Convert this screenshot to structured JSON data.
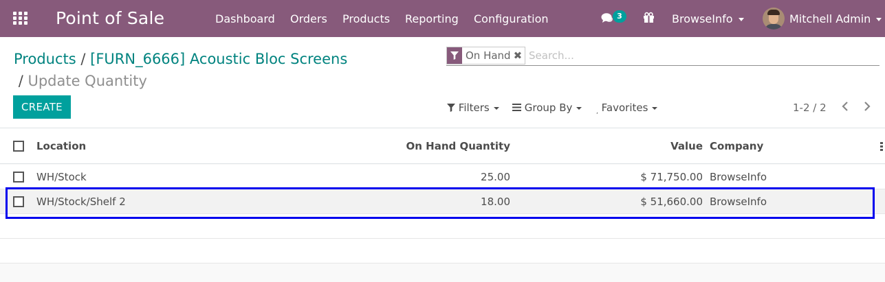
{
  "navbar": {
    "app_title": "Point of Sale",
    "menus": [
      "Dashboard",
      "Orders",
      "Products",
      "Reporting",
      "Configuration"
    ],
    "messages_badge": "3",
    "company": "BrowseInfo",
    "user": "Mitchell Admin",
    "bg_color": "#875a7b"
  },
  "breadcrumb": {
    "items": [
      "Products",
      "[FURN_6666] Acoustic Bloc Screens"
    ],
    "current": "Update Quantity"
  },
  "toolbar": {
    "create_label": "CREATE",
    "filters_label": "Filters",
    "groupby_label": "Group By",
    "favorites_label": "Favorites",
    "pager": "1-2 / 2"
  },
  "search": {
    "facet_label": "On Hand",
    "facet_icon": "filter-icon",
    "placeholder": "Search..."
  },
  "table": {
    "columns": [
      "Location",
      "On Hand Quantity",
      "Value",
      "Company"
    ],
    "rows": [
      {
        "location": "WH/Stock",
        "quantity": "25.00",
        "value": "$ 71,750.00",
        "company": "BrowseInfo"
      },
      {
        "location": "WH/Stock/Shelf 2",
        "quantity": "18.00",
        "value": "$ 51,660.00",
        "company": "BrowseInfo"
      }
    ]
  },
  "colors": {
    "accent": "#00a09d",
    "link": "#00837f",
    "highlight_border": "#0000ee"
  }
}
